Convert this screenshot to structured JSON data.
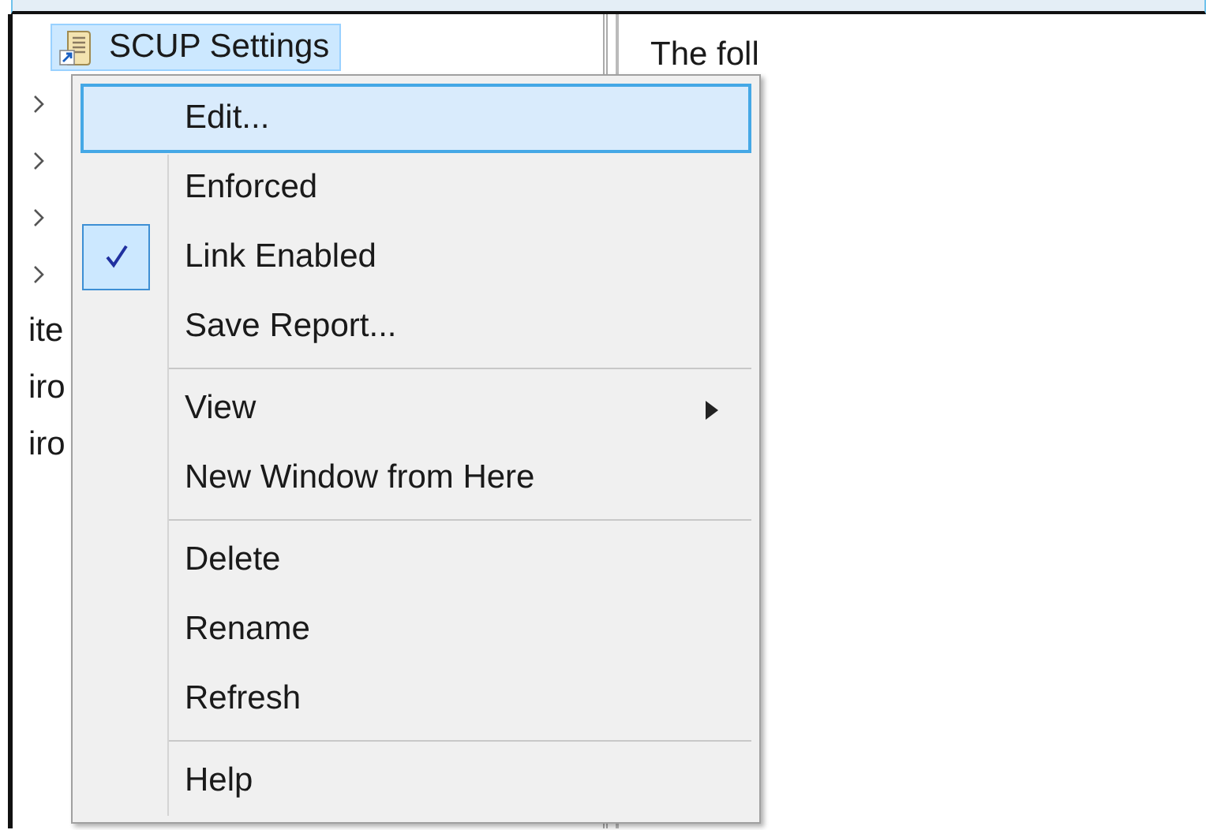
{
  "tree": {
    "items": [
      {
        "kind": "leaf",
        "label": "SCUP Settings",
        "selected": true
      },
      {
        "kind": "folder",
        "selected": false,
        "expanded": false
      },
      {
        "kind": "folder",
        "selected": false,
        "expanded": false
      },
      {
        "kind": "folder",
        "selected": false,
        "expanded": false
      },
      {
        "kind": "folder",
        "selected": false,
        "expanded": false
      },
      {
        "kind": "text",
        "label": "ite",
        "selected": false
      },
      {
        "kind": "text",
        "label": "iro",
        "selected": false
      },
      {
        "kind": "text",
        "label": "iro",
        "selected": false
      }
    ]
  },
  "details_pane": {
    "text": "The foll"
  },
  "context_menu": {
    "items": [
      {
        "kind": "item",
        "label": "Edit...",
        "selected": true,
        "checked": false,
        "has_submenu": false
      },
      {
        "kind": "item",
        "label": "Enforced",
        "selected": false,
        "checked": false,
        "has_submenu": false
      },
      {
        "kind": "item",
        "label": "Link Enabled",
        "selected": false,
        "checked": true,
        "has_submenu": false
      },
      {
        "kind": "item",
        "label": "Save Report...",
        "selected": false,
        "checked": false,
        "has_submenu": false
      },
      {
        "kind": "separator"
      },
      {
        "kind": "item",
        "label": "View",
        "selected": false,
        "checked": false,
        "has_submenu": true
      },
      {
        "kind": "item",
        "label": "New Window from Here",
        "selected": false,
        "checked": false,
        "has_submenu": false
      },
      {
        "kind": "separator"
      },
      {
        "kind": "item",
        "label": "Delete",
        "selected": false,
        "checked": false,
        "has_submenu": false
      },
      {
        "kind": "item",
        "label": "Rename",
        "selected": false,
        "checked": false,
        "has_submenu": false
      },
      {
        "kind": "item",
        "label": "Refresh",
        "selected": false,
        "checked": false,
        "has_submenu": false
      },
      {
        "kind": "separator"
      },
      {
        "kind": "item",
        "label": "Help",
        "selected": false,
        "checked": false,
        "has_submenu": false
      }
    ]
  }
}
